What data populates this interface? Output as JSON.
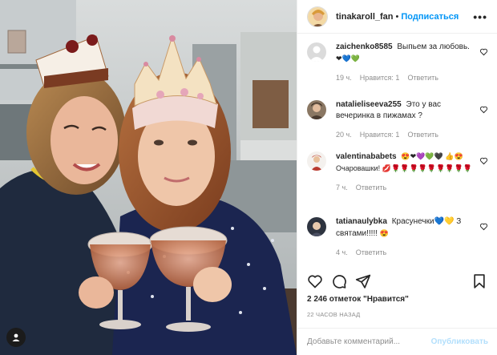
{
  "post": {
    "author": "tinakaroll_fan",
    "follow_label": "Подписаться",
    "separator": "•",
    "more_label": "•••"
  },
  "comments": [
    {
      "user": "zaichenko8585",
      "text": "Выпьем за любовь.",
      "emojis": "❤💙💚",
      "age": "19 ч.",
      "likes_label": "Нравится: 1",
      "reply_label": "Ответить"
    },
    {
      "user": "natalieliseeva255",
      "text": "Это у вас вечеринка в пижамах ?",
      "emojis": "",
      "age": "20 ч.",
      "likes_label": "Нравится: 1",
      "reply_label": "Ответить"
    },
    {
      "user": "valentinababets",
      "text": "😍❤💜💚🖤 👍😍Очаровашки!",
      "emojis": "💋🌹🌹🌹🌹🌹🌹🌹🌹🌹",
      "age": "7 ч.",
      "likes_label": "",
      "reply_label": "Ответить"
    },
    {
      "user": "tatianaulybka",
      "text": "Красунечки💙💛 З святами!!!!!",
      "emojis": "😍",
      "age": "4 ч.",
      "likes_label": "",
      "reply_label": "Ответить"
    }
  ],
  "stats": {
    "likes": "2 246 отметок \"Нравится\"",
    "posted": "22 ЧАСОВ НАЗАД"
  },
  "composer": {
    "placeholder": "Добавьте комментарий...",
    "post_label": "Опубликовать"
  },
  "icons": [
    "heart-icon",
    "comment-icon",
    "share-icon",
    "bookmark-icon",
    "user-tag-icon",
    "more-icon"
  ],
  "colors": {
    "link": "#0095f6",
    "muted": "#8e8e8e",
    "post_disabled": "#b2dffc"
  }
}
